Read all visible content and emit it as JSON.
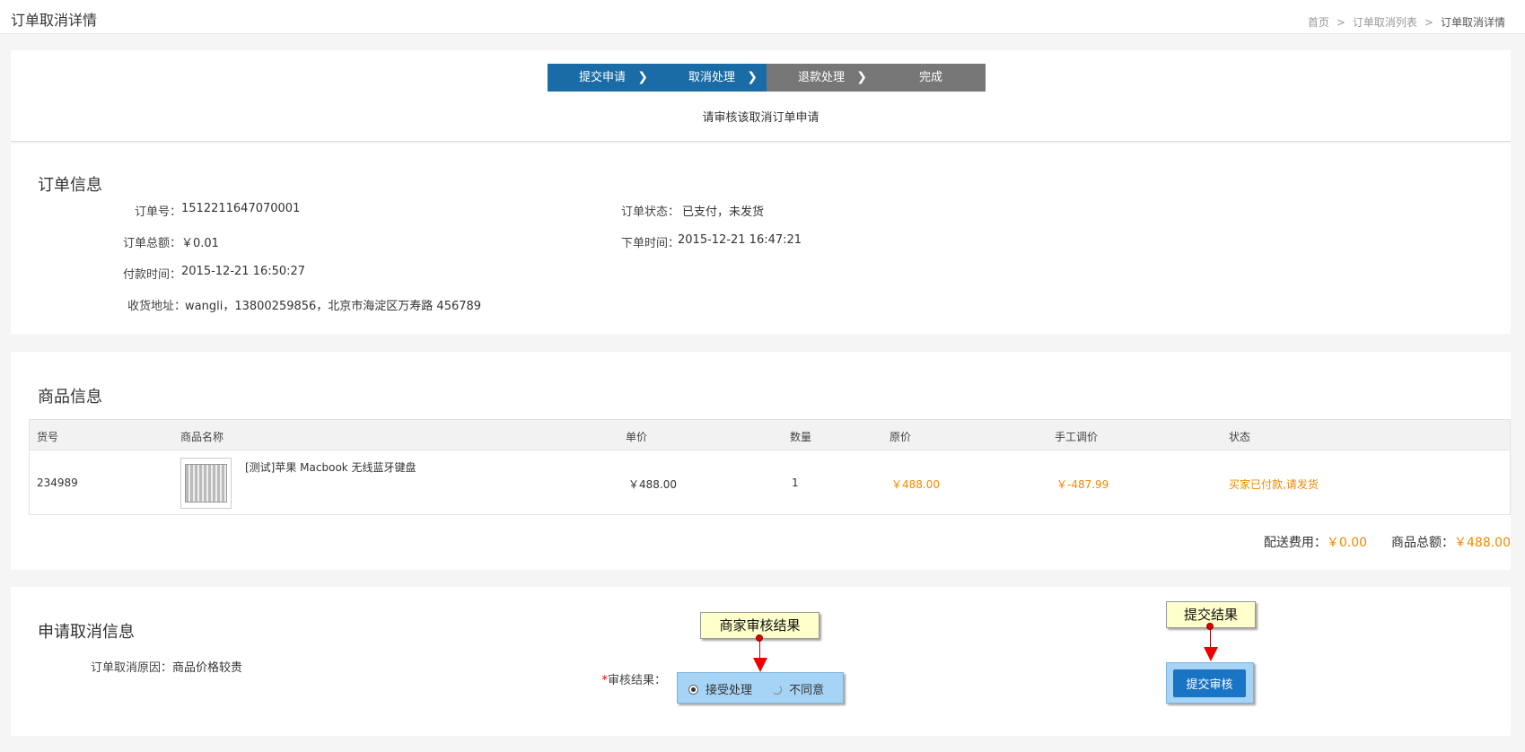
{
  "page": {
    "title": "订单取消详情",
    "breadcrumb": [
      "首页",
      "订单取消列表",
      "订单取消详情"
    ],
    "breadcrumb_sep": ">"
  },
  "steps": [
    {
      "label": "提交申请",
      "state": "done"
    },
    {
      "label": "取消处理",
      "state": "done"
    },
    {
      "label": "退款处理",
      "state": "todo"
    },
    {
      "label": "完成",
      "state": "todo"
    }
  ],
  "hint": "请审核该取消订单申请",
  "order_info": {
    "title": "订单信息",
    "order_no_label": "订单号：",
    "order_no": "1512211647070001",
    "status_label": "订单状态：",
    "status": "已支付，未发货",
    "amount_label": "订单总额：",
    "amount": "￥0.01",
    "order_time_label": "下单时间：",
    "order_time": "2015-12-21 16:47:21",
    "pay_time_label": "付款时间：",
    "pay_time": "2015-12-21 16:50:27",
    "address_label": "收货地址：",
    "address": "wangli，13800259856，北京市海淀区万寿路  456789"
  },
  "goods_info": {
    "title": "商品信息",
    "headers": [
      "货号",
      "商品名称",
      "单价",
      "数量",
      "原价",
      "手工调价",
      "状态"
    ],
    "rows": [
      {
        "sku": "234989",
        "name": "[测试]苹果 Macbook 无线蓝牙键盘",
        "unit_price": "￥488.00",
        "qty": "1",
        "orig_price": "￥488.00",
        "adjust": "￥-487.99",
        "status": "买家已付款,请发货"
      }
    ],
    "shipping_label": "配送费用：",
    "shipping": "￥0.00",
    "total_label": "商品总额：",
    "total": "￥488.00"
  },
  "cancel_info": {
    "title": "申请取消信息",
    "reason_label": "订单取消原因：",
    "reason": "商品价格较贵",
    "required_mark": "*",
    "review_label": "审核结果：",
    "options": [
      "接受处理",
      "不同意"
    ],
    "selected": "接受处理",
    "submit_label": "提交审核"
  },
  "callouts": {
    "review": "商家审核结果",
    "submit": "提交结果"
  },
  "colors": {
    "step_done": "#1a6ca6",
    "step_todo": "#777777",
    "accent_orange": "#f08a00",
    "button_blue": "#1a74c4",
    "callout_bg": "#ffffcc",
    "highlight_bg": "#a6d4f6"
  },
  "icons": [
    "chevron-right-icon",
    "product-thumbnail",
    "radio-checked-icon",
    "radio-unchecked-icon",
    "arrow-annotation"
  ]
}
